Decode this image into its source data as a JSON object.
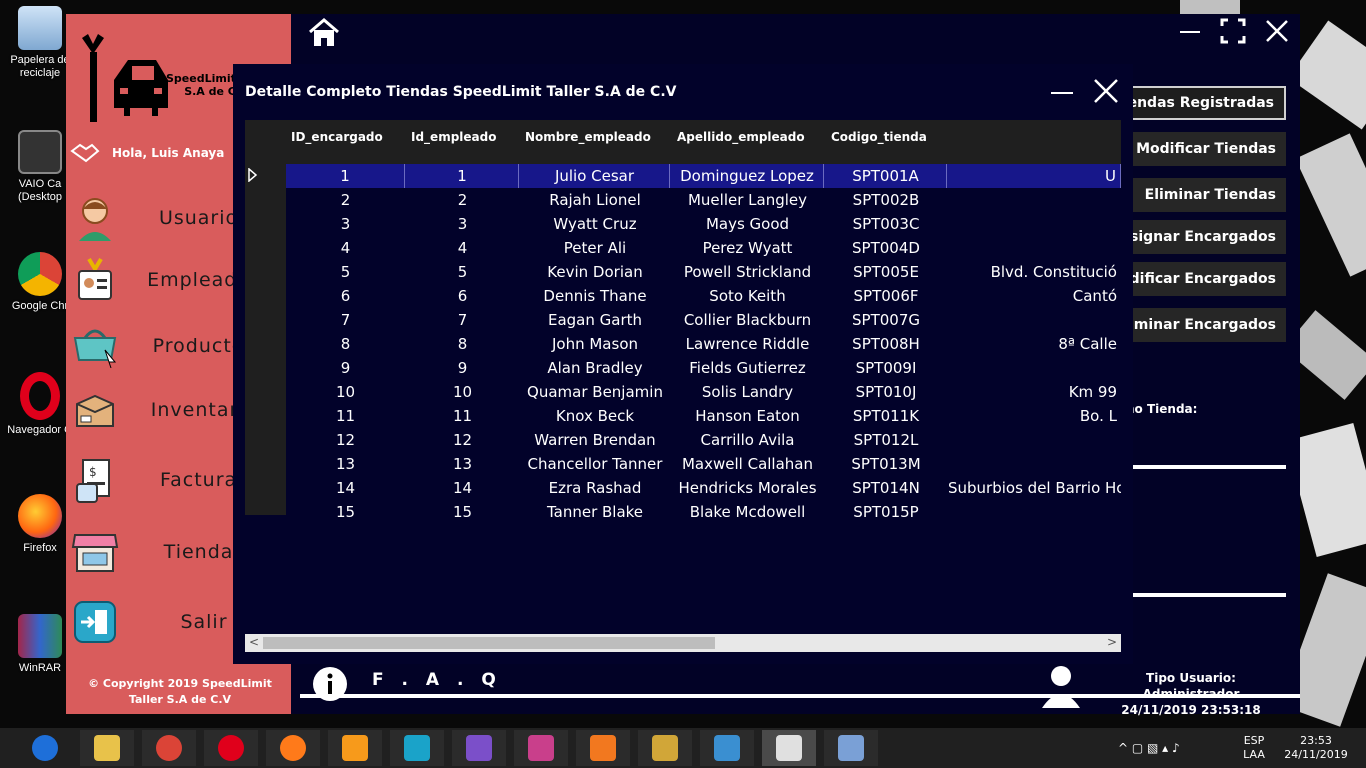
{
  "desktop": {
    "icons": [
      {
        "label": "Papelera de\nreciclaje",
        "name": "recycle-bin-icon"
      },
      {
        "label": "VAIO Ca\n(Desktop",
        "name": "vaio-icon"
      },
      {
        "label": "Google Chr",
        "name": "chrome-desktop-icon"
      },
      {
        "label": "Navegador O",
        "name": "opera-desktop-icon"
      },
      {
        "label": "Firefox",
        "name": "firefox-desktop-icon"
      },
      {
        "label": "WinRAR",
        "name": "winrar-desktop-icon"
      }
    ]
  },
  "sidebar": {
    "brand": "SpeedLimit\nS.A de C",
    "greeting": "Hola, Luis Anaya",
    "items": [
      {
        "label": "Usuarios",
        "icon": "user-icon"
      },
      {
        "label": "Empleados",
        "icon": "badge-icon"
      },
      {
        "label": "Productos",
        "icon": "basket-icon"
      },
      {
        "label": "Inventario",
        "icon": "box-icon"
      },
      {
        "label": "Facturas",
        "icon": "invoice-icon"
      },
      {
        "label": "Tiendas",
        "icon": "store-icon"
      },
      {
        "label": "Salir",
        "icon": "exit-icon"
      }
    ],
    "copyright": "© Copyright 2019 SpeedLimit\nTaller S.A de C.V"
  },
  "right_buttons": [
    {
      "label": "Tiendas Registradas"
    },
    {
      "label": "Modificar Tiendas"
    },
    {
      "label": "Eliminar Tiendas"
    },
    {
      "label": "Asignar Encargados"
    },
    {
      "label": "Modificar Encargados"
    },
    {
      "label": "Eliminar Encargados"
    }
  ],
  "right_label": "no Tienda:",
  "bottombar": {
    "faq": "F . A . Q",
    "user_type": "Tipo Usuario: Administrador",
    "datetime": "24/11/2019 23:53:18"
  },
  "dialog": {
    "title": "Detalle Completo Tiendas SpeedLimit Taller S.A de C.V",
    "columns": [
      "ID_encargado",
      "Id_empleado",
      "Nombre_empleado",
      "Apellido_empleado",
      "Codigo_tienda"
    ],
    "rows": [
      {
        "id_enc": "1",
        "id_emp": "1",
        "nombre": "Julio Cesar",
        "apellido": "Dominguez Lopez",
        "codigo": "SPT001A",
        "dir": "U"
      },
      {
        "id_enc": "2",
        "id_emp": "2",
        "nombre": "Rajah Lionel",
        "apellido": "Mueller Langley",
        "codigo": "SPT002B",
        "dir": ""
      },
      {
        "id_enc": "3",
        "id_emp": "3",
        "nombre": "Wyatt Cruz",
        "apellido": "Mays Good",
        "codigo": "SPT003C",
        "dir": ""
      },
      {
        "id_enc": "4",
        "id_emp": "4",
        "nombre": "Peter Ali",
        "apellido": "Perez Wyatt",
        "codigo": "SPT004D",
        "dir": ""
      },
      {
        "id_enc": "5",
        "id_emp": "5",
        "nombre": "Kevin Dorian",
        "apellido": "Powell Strickland",
        "codigo": "SPT005E",
        "dir": "Blvd. Constitució"
      },
      {
        "id_enc": "6",
        "id_emp": "6",
        "nombre": "Dennis Thane",
        "apellido": "Soto Keith",
        "codigo": "SPT006F",
        "dir": "Cantó"
      },
      {
        "id_enc": "7",
        "id_emp": "7",
        "nombre": "Eagan Garth",
        "apellido": "Collier Blackburn",
        "codigo": "SPT007G",
        "dir": ""
      },
      {
        "id_enc": "8",
        "id_emp": "8",
        "nombre": "John Mason",
        "apellido": "Lawrence Riddle",
        "codigo": "SPT008H",
        "dir": "8ª Calle"
      },
      {
        "id_enc": "9",
        "id_emp": "9",
        "nombre": "Alan Bradley",
        "apellido": "Fields Gutierrez",
        "codigo": "SPT009I",
        "dir": ""
      },
      {
        "id_enc": "10",
        "id_emp": "10",
        "nombre": "Quamar Benjamin",
        "apellido": "Solis Landry",
        "codigo": "SPT010J",
        "dir": "Km 99"
      },
      {
        "id_enc": "11",
        "id_emp": "11",
        "nombre": "Knox Beck",
        "apellido": "Hanson Eaton",
        "codigo": "SPT011K",
        "dir": "Bo. L"
      },
      {
        "id_enc": "12",
        "id_emp": "12",
        "nombre": "Warren Brendan",
        "apellido": "Carrillo Avila",
        "codigo": "SPT012L",
        "dir": ""
      },
      {
        "id_enc": "13",
        "id_emp": "13",
        "nombre": "Chancellor Tanner",
        "apellido": "Maxwell Callahan",
        "codigo": "SPT013M",
        "dir": ""
      },
      {
        "id_enc": "14",
        "id_emp": "14",
        "nombre": "Ezra Rashad",
        "apellido": "Hendricks Morales",
        "codigo": "SPT014N",
        "dir": "Suburbios del Barrio Ho"
      },
      {
        "id_enc": "15",
        "id_emp": "15",
        "nombre": "Tanner Blake",
        "apellido": "Blake Mcdowell",
        "codigo": "SPT015P",
        "dir": ""
      }
    ]
  },
  "taskbar": {
    "apps": [
      "ie-icon",
      "file-explorer-icon",
      "chrome-icon",
      "opera-icon",
      "firefox-icon",
      "sublime-icon",
      "powershell-icon",
      "visual-studio-icon",
      "winrar-icon",
      "xampp-icon",
      "tools-icon",
      "virtualbox-icon",
      "plugin-icon",
      "paint-icon"
    ],
    "lang": "ESP",
    "lang2": "LAA",
    "time": "23:53",
    "date": "24/11/2019"
  }
}
